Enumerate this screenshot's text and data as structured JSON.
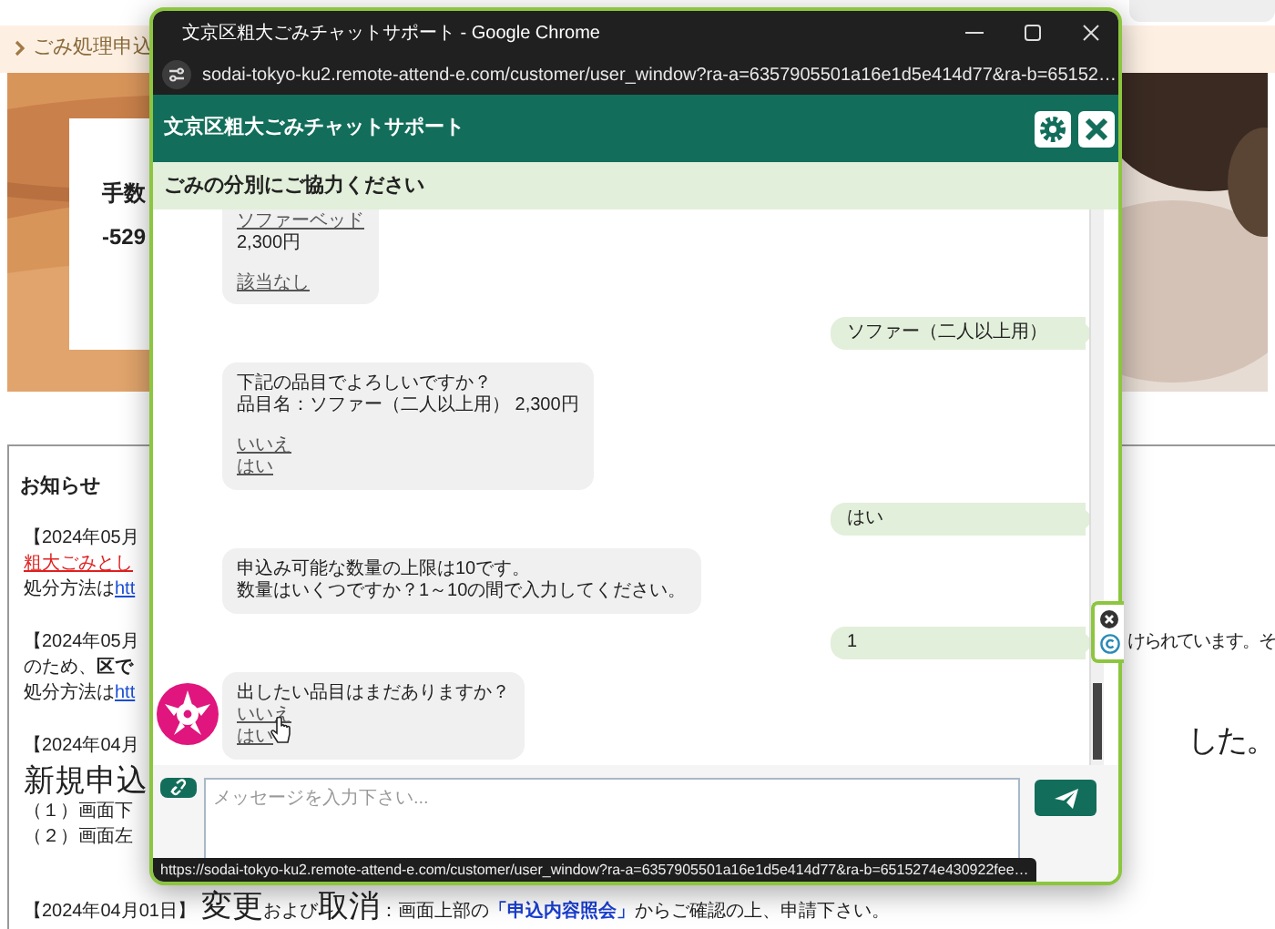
{
  "page": {
    "breadcrumb": "ごみ処理申込",
    "hero": {
      "kind": "picture",
      "card_lines": [
        "手数",
        "-529"
      ]
    },
    "notices": {
      "heading": "お知らせ",
      "items": [
        {
          "lines": [
            {
              "left": [
                {
                  "kind": "text",
                  "text": "【2024年05月"
                }
              ]
            },
            {
              "left": [
                {
                  "kind": "alert_link",
                  "text": "粗大ごみとし"
                }
              ]
            },
            {
              "left": [
                {
                  "kind": "text",
                  "text": "処分方法は"
                },
                {
                  "kind": "link",
                  "text": "htt"
                }
              ]
            }
          ]
        },
        {
          "lines": [
            {
              "left": [
                {
                  "kind": "text",
                  "text": "【2024年05月"
                }
              ],
              "right": {
                "kind": "text",
                "text": "けられています。そ"
              }
            },
            {
              "left": [
                {
                  "kind": "text",
                  "text": "のため、**区で**"
                }
              ]
            },
            {
              "left": [
                {
                  "kind": "text",
                  "text": "処分方法は"
                },
                {
                  "kind": "link",
                  "text": "htt"
                }
              ]
            }
          ]
        },
        {
          "lines": [
            {
              "left": [
                {
                  "kind": "text",
                  "text": "【2024年04月"
                }
              ],
              "right": {
                "kind": "large",
                "text": "した。"
              }
            },
            {
              "left": [
                {
                  "kind": "large",
                  "text": "新規申込"
                }
              ]
            },
            {
              "left": [
                {
                  "kind": "text",
                  "text": "（１）画面下"
                }
              ]
            },
            {
              "left": [
                {
                  "kind": "text",
                  "text": "（２）画面左"
                }
              ]
            }
          ]
        }
      ],
      "footer_line": [
        {
          "kind": "text",
          "text": "【2024年04月01日】 "
        },
        {
          "kind": "large",
          "text": "変更"
        },
        {
          "kind": "text",
          "text": "および"
        },
        {
          "kind": "large",
          "text": "取消"
        },
        {
          "kind": "text",
          "text": "：画面上部の"
        },
        {
          "kind": "emphasis",
          "text": "「申込内容照会」"
        },
        {
          "kind": "text",
          "text": "からご確認の上、申請下さい。"
        }
      ]
    }
  },
  "window": {
    "title": "文京区粗大ごみチャットサポート - Google Chrome",
    "url": "sodai-tokyo-ku2.remote-attend-e.com/customer/user_window?ra-a=6357905501a16e1d5e414d77&ra-b=65152…",
    "header": "文京区粗大ごみチャットサポート",
    "notice": "ごみの分別にご協力ください",
    "messages": [
      {
        "kind": "bot",
        "avatar": false,
        "lines": [
          {
            "kind": "link",
            "text": "ソファーベッド"
          },
          {
            "kind": "text",
            "text": "2,300円"
          },
          {
            "kind": "gap"
          },
          {
            "kind": "link",
            "text": "該当なし"
          }
        ]
      },
      {
        "kind": "user",
        "avatar": false,
        "lines": [
          {
            "kind": "text",
            "text": "ソファー（二人以上用）"
          }
        ]
      },
      {
        "kind": "bot",
        "avatar": false,
        "lines": [
          {
            "kind": "text",
            "text": "下記の品目でよろしいですか？"
          },
          {
            "kind": "text",
            "text": "品目名：ソファー（二人以上用） 2,300円"
          },
          {
            "kind": "gap"
          },
          {
            "kind": "link",
            "text": "いいえ"
          },
          {
            "kind": "link",
            "text": "はい"
          }
        ]
      },
      {
        "kind": "user",
        "avatar": false,
        "lines": [
          {
            "kind": "text",
            "text": "はい"
          }
        ]
      },
      {
        "kind": "bot",
        "avatar": false,
        "lines": [
          {
            "kind": "text",
            "text": "申込み可能な数量の上限は10です。"
          },
          {
            "kind": "text",
            "text": "数量はいくつですか？1～10の間で入力してください。"
          }
        ]
      },
      {
        "kind": "user",
        "avatar": false,
        "lines": [
          {
            "kind": "text",
            "text": "1"
          }
        ]
      },
      {
        "kind": "bot",
        "avatar": true,
        "lines": [
          {
            "kind": "text",
            "text": "出したい品目はまだありますか？"
          },
          {
            "kind": "link",
            "text": "いいえ",
            "hovered": true
          },
          {
            "kind": "link",
            "text": "はい"
          }
        ]
      }
    ],
    "input": {
      "placeholder": "メッセージを入力下さい..."
    },
    "status_url": "https://sodai-tokyo-ku2.remote-attend-e.com/customer/user_window?ra-a=6357905501a16e1d5e414d77&ra-b=6515274e430922fee…"
  }
}
